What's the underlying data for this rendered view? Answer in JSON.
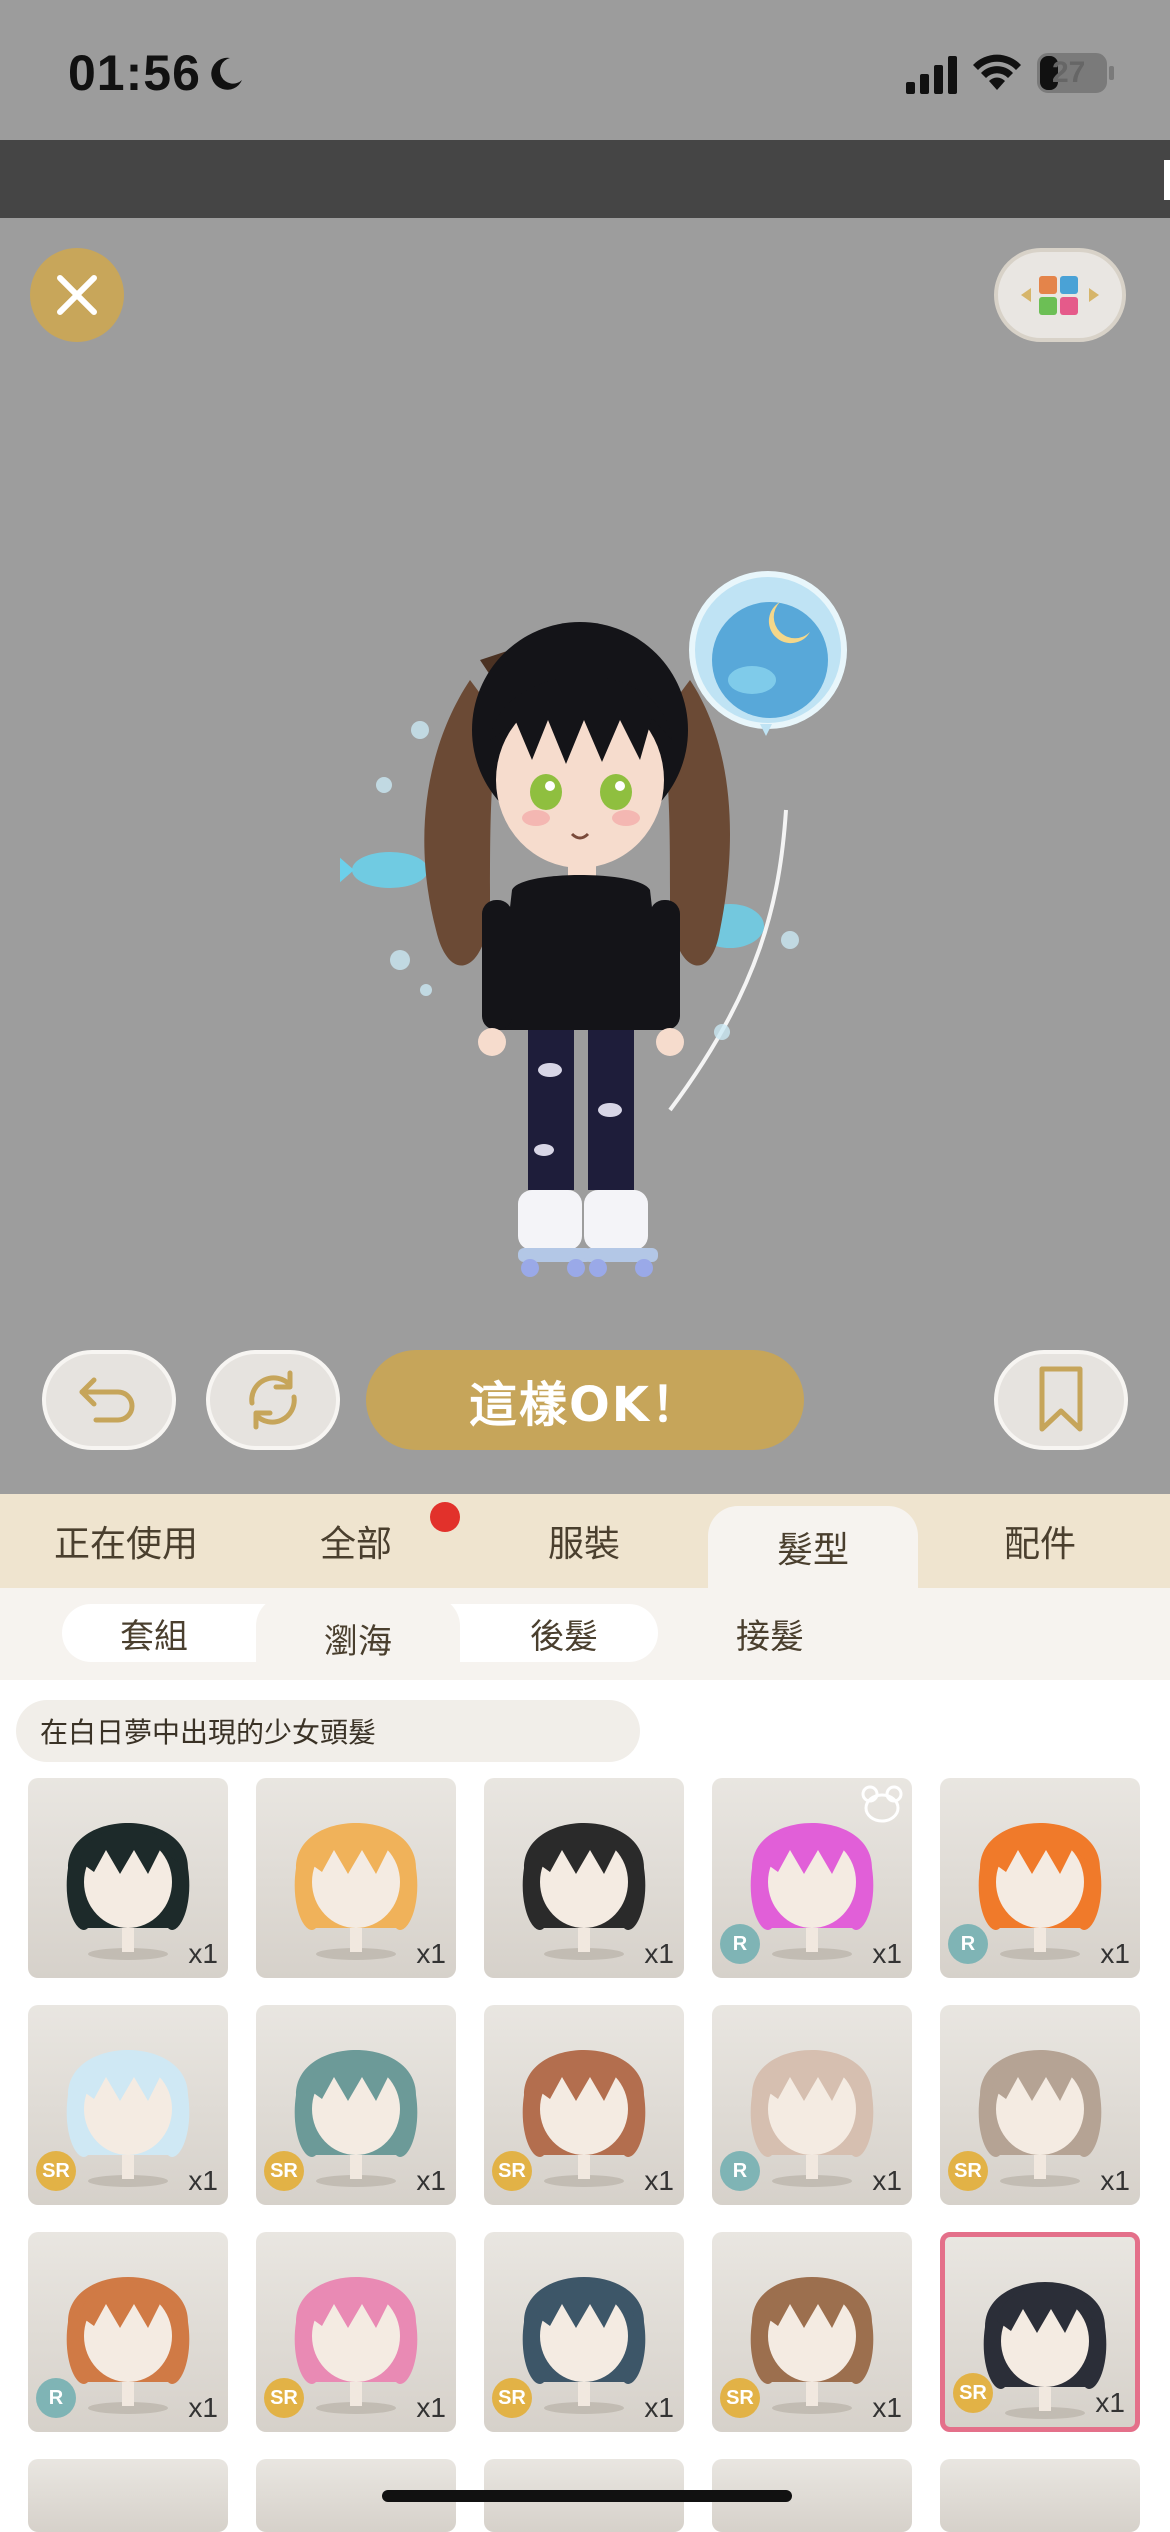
{
  "status": {
    "time": "01:56",
    "battery": "27"
  },
  "actions": {
    "ok_label": "這樣OK！"
  },
  "tabs": [
    {
      "label": "正在使用"
    },
    {
      "label": "全部"
    },
    {
      "label": "服裝"
    },
    {
      "label": "髮型"
    },
    {
      "label": "配件"
    }
  ],
  "subtabs": [
    {
      "label": "套組"
    },
    {
      "label": "瀏海"
    },
    {
      "label": "後髮"
    },
    {
      "label": "接髮"
    }
  ],
  "section_title": "在白日夢中出現的少女頭髮",
  "items": [
    {
      "qty": "x1",
      "rarity": "",
      "hair": "#1d2a2a"
    },
    {
      "qty": "x1",
      "rarity": "",
      "hair": "#f0b25a"
    },
    {
      "qty": "x1",
      "rarity": "",
      "hair": "#2a2a2a"
    },
    {
      "qty": "x1",
      "rarity": "R",
      "hair": "#e15fd8"
    },
    {
      "qty": "x1",
      "rarity": "R",
      "hair": "#f07a2a"
    },
    {
      "qty": "x1",
      "rarity": "SR",
      "hair": "#cfe8f4"
    },
    {
      "qty": "x1",
      "rarity": "SR",
      "hair": "#6c9a98"
    },
    {
      "qty": "x1",
      "rarity": "SR",
      "hair": "#b36e4e"
    },
    {
      "qty": "x1",
      "rarity": "R",
      "hair": "#d6bfb0"
    },
    {
      "qty": "x1",
      "rarity": "SR",
      "hair": "#b5a394"
    },
    {
      "qty": "x1",
      "rarity": "R",
      "hair": "#d07a45"
    },
    {
      "qty": "x1",
      "rarity": "SR",
      "hair": "#e98ab4"
    },
    {
      "qty": "x1",
      "rarity": "SR",
      "hair": "#3d5668"
    },
    {
      "qty": "x1",
      "rarity": "SR",
      "hair": "#9c6f4e"
    },
    {
      "qty": "x1",
      "rarity": "SR",
      "hair": "#2b2e38"
    }
  ]
}
